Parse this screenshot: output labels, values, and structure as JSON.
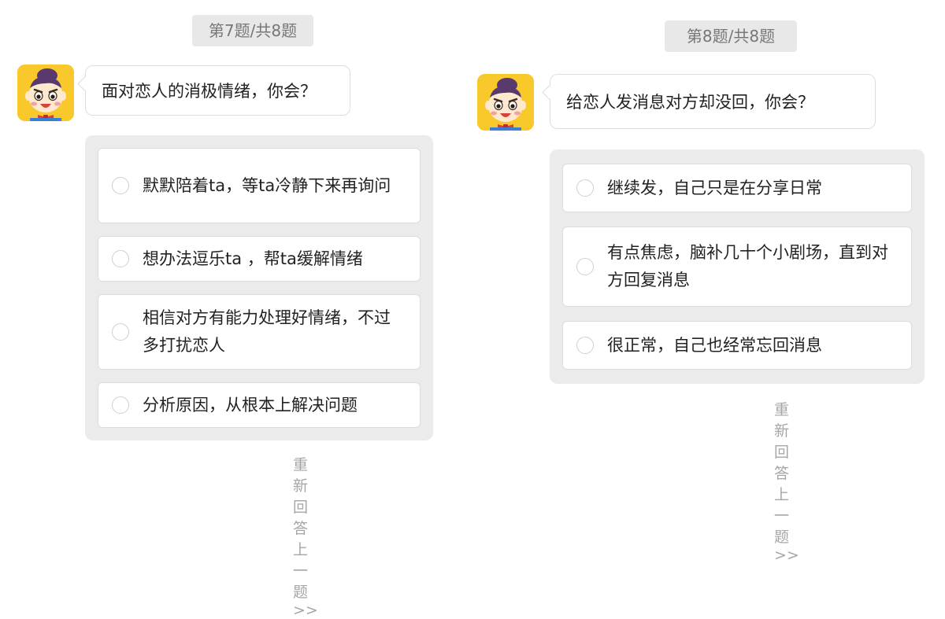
{
  "questions": [
    {
      "progress": "第7题/共8题",
      "avatar_icon": "cartoon-boy-avatar",
      "question": "面对恋人的消极情绪，你会？",
      "options": [
        "默默陪着ta，等ta冷静下来再询问",
        "想办法逗乐ta ，帮ta缓解情绪",
        "相信对方有能力处理好情绪，不过多打扰恋人",
        "分析原因，从根本上解决问题"
      ],
      "redo": "重新回答上一题>>"
    },
    {
      "progress": "第8题/共8题",
      "avatar_icon": "cartoon-boy-avatar",
      "question": "给恋人发消息对方却没回，你会？",
      "options": [
        "继续发，自己只是在分享日常",
        "有点焦虑，脑补几十个小剧场，直到对方回复消息",
        "很正常，自己也经常忘回消息"
      ],
      "redo": "重新回答上一题>>"
    }
  ],
  "colors": {
    "avatar_bg": "#f9c82a",
    "options_bg": "#ebebeb",
    "badge_bg": "#e8e8e8",
    "muted_text": "#a6a6a6"
  }
}
